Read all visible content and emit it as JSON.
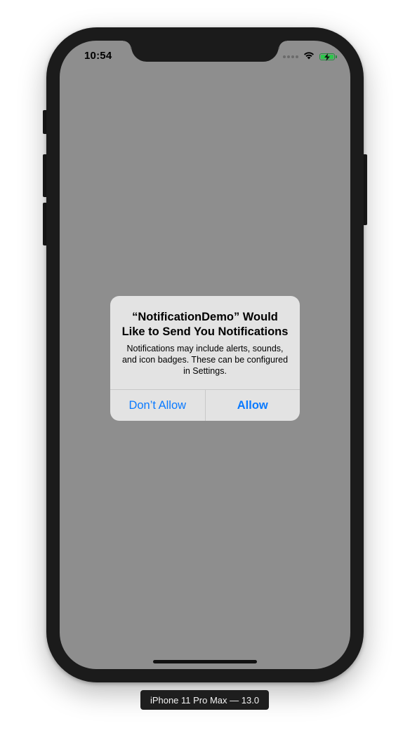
{
  "status_bar": {
    "time": "10:54",
    "icons": [
      "cellular-signal-icon",
      "wifi-icon",
      "battery-charging-icon"
    ]
  },
  "alert": {
    "title": "“NotificationDemo” Would Like to Send You Notifications",
    "message": "Notifications may include alerts, sounds, and icon badges. These can be configured in Settings.",
    "buttons": {
      "deny": "Don’t Allow",
      "allow": "Allow"
    }
  },
  "simulator": {
    "device_label": "iPhone 11 Pro Max — 13.0"
  },
  "colors": {
    "screen_background": "#8e8e8e",
    "alert_background": "#e3e3e3",
    "accent": "#0a7aff",
    "frame": "#1b1b1b",
    "battery": "#2cc84a"
  }
}
